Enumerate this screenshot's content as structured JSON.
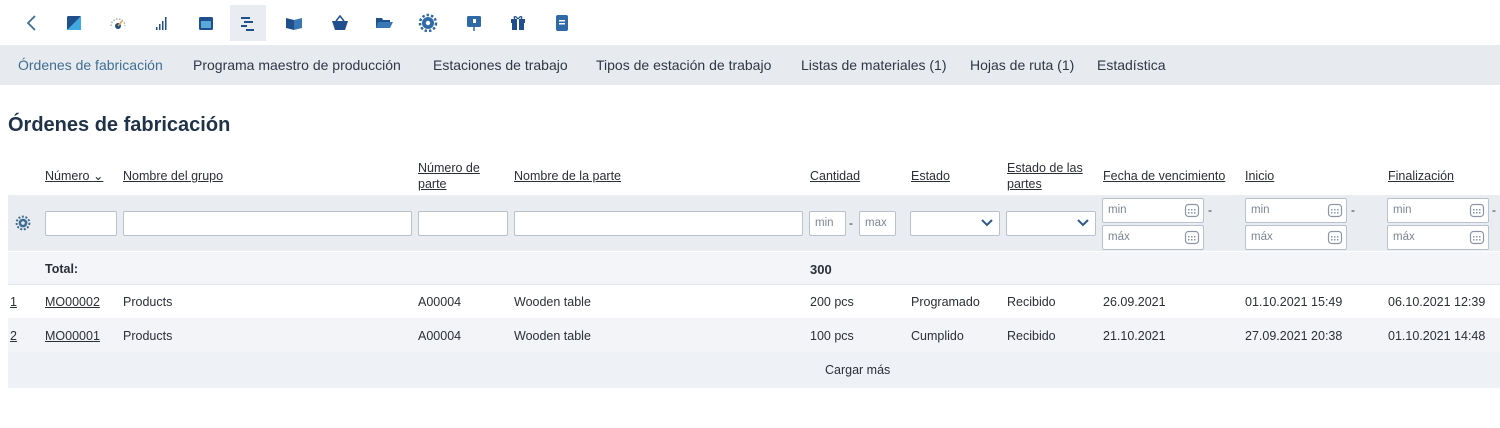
{
  "toolbar": {
    "icons": [
      "back-icon",
      "dashboard-icon",
      "gauge-icon",
      "bar-chart-icon",
      "calendar-icon",
      "gantt-icon",
      "book-icon",
      "basket-icon",
      "folder-icon",
      "gear-icon",
      "presentation-icon",
      "gift-icon",
      "document-icon"
    ],
    "active": "gantt-icon",
    "accent": "#1f4f8c"
  },
  "subnav": {
    "tabs": [
      "Órdenes de fabricación",
      "Programa maestro de producción",
      "Estaciones de trabajo",
      "Tipos de estación de trabajo",
      "Listas de materiales (1)",
      "Hojas de ruta (1)",
      "Estadística"
    ],
    "active_index": 0
  },
  "page_title": "Órdenes de fabricación",
  "table": {
    "headers": {
      "numero": "Número",
      "grupo": "Nombre del grupo",
      "numero_parte_1": "Número de",
      "numero_parte_2": "parte",
      "nombre_parte": "Nombre de la parte",
      "cantidad": "Cantidad",
      "estado": "Estado",
      "estado_partes_1": "Estado de las",
      "estado_partes_2": "partes",
      "vencimiento": "Fecha de vencimiento",
      "inicio": "Inicio",
      "finalizacion": "Finalización"
    },
    "filters": {
      "min": "min",
      "max": "max",
      "date_min": "min",
      "date_max": "máx",
      "dash": "-"
    },
    "total_label": "Total:",
    "total_cantidad": "300",
    "rows": [
      {
        "idx": "1",
        "numero": "MO00002",
        "grupo": "Products",
        "parte": "A00004",
        "nombre_parte": "Wooden table",
        "cantidad": "200 pcs",
        "estado": "Programado",
        "estado_partes": "Recibido",
        "vencimiento": "26.09.2021",
        "inicio": "01.10.2021 15:49",
        "fin": "06.10.2021 12:39"
      },
      {
        "idx": "2",
        "numero": "MO00001",
        "grupo": "Products",
        "parte": "A00004",
        "nombre_parte": "Wooden table",
        "cantidad": "100 pcs",
        "estado": "Cumplido",
        "estado_partes": "Recibido",
        "vencimiento": "21.10.2021",
        "inicio": "27.09.2021 20:38",
        "fin": "01.10.2021 14:48"
      }
    ],
    "load_more": "Cargar más"
  }
}
